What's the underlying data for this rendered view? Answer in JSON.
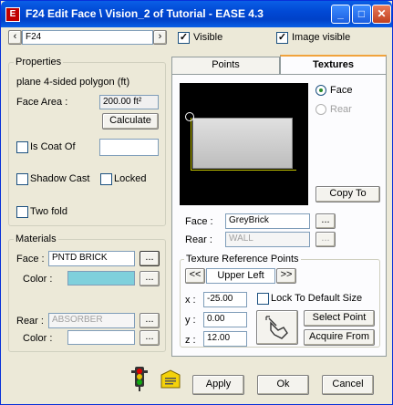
{
  "window": {
    "title": "F24 Edit Face \\ Vision_2 of Tutorial - EASE 4.3"
  },
  "titlebar": {
    "minimize": "_",
    "maximize": "□",
    "close": "✕"
  },
  "top": {
    "prev": "‹",
    "next": "›",
    "face_id": "F24",
    "visible_label": "Visible",
    "image_visible_label": "Image visible",
    "visible_checked": "✓",
    "image_visible_checked": "✓"
  },
  "properties": {
    "title": "Properties",
    "description": "plane  4-sided polygon  (ft)",
    "face_area_label": "Face Area :",
    "face_area_value": "200.00 ft²",
    "calculate_label": "Calculate",
    "is_coat_of_label": "Is Coat Of",
    "is_coat_of_value": "",
    "shadow_cast_label": "Shadow Cast",
    "locked_label": "Locked",
    "two_fold_label": "Two fold"
  },
  "materials": {
    "title": "Materials",
    "face_label": "Face :",
    "face_value": "PNTD BRICK",
    "face_color_label": "Color :",
    "face_color": "#7fd0dc",
    "rear_label": "Rear :",
    "rear_value": "ABSORBER",
    "rear_color_label": "Color :",
    "browse": "..."
  },
  "tabs": {
    "points": "Points",
    "textures": "Textures"
  },
  "textures": {
    "face_radio": "Face",
    "rear_radio": "Rear",
    "copy_to": "Copy To",
    "face_label": "Face :",
    "face_value": "GreyBrick",
    "rear_label": "Rear :",
    "rear_value": "WALL",
    "browse": "..."
  },
  "texture_ref": {
    "title": "Texture Reference Points",
    "prev": "<<",
    "next": ">>",
    "position": "Upper Left",
    "x_label": "x :",
    "x_value": "-25.00",
    "y_label": "y :",
    "y_value": "0.00",
    "z_label": "z :",
    "z_value": "12.00",
    "lock_label": "Lock To Default Size",
    "select_point": "Select Point",
    "acquire_from": "Acquire From"
  },
  "footer": {
    "apply": "Apply",
    "ok": "Ok",
    "cancel": "Cancel"
  }
}
